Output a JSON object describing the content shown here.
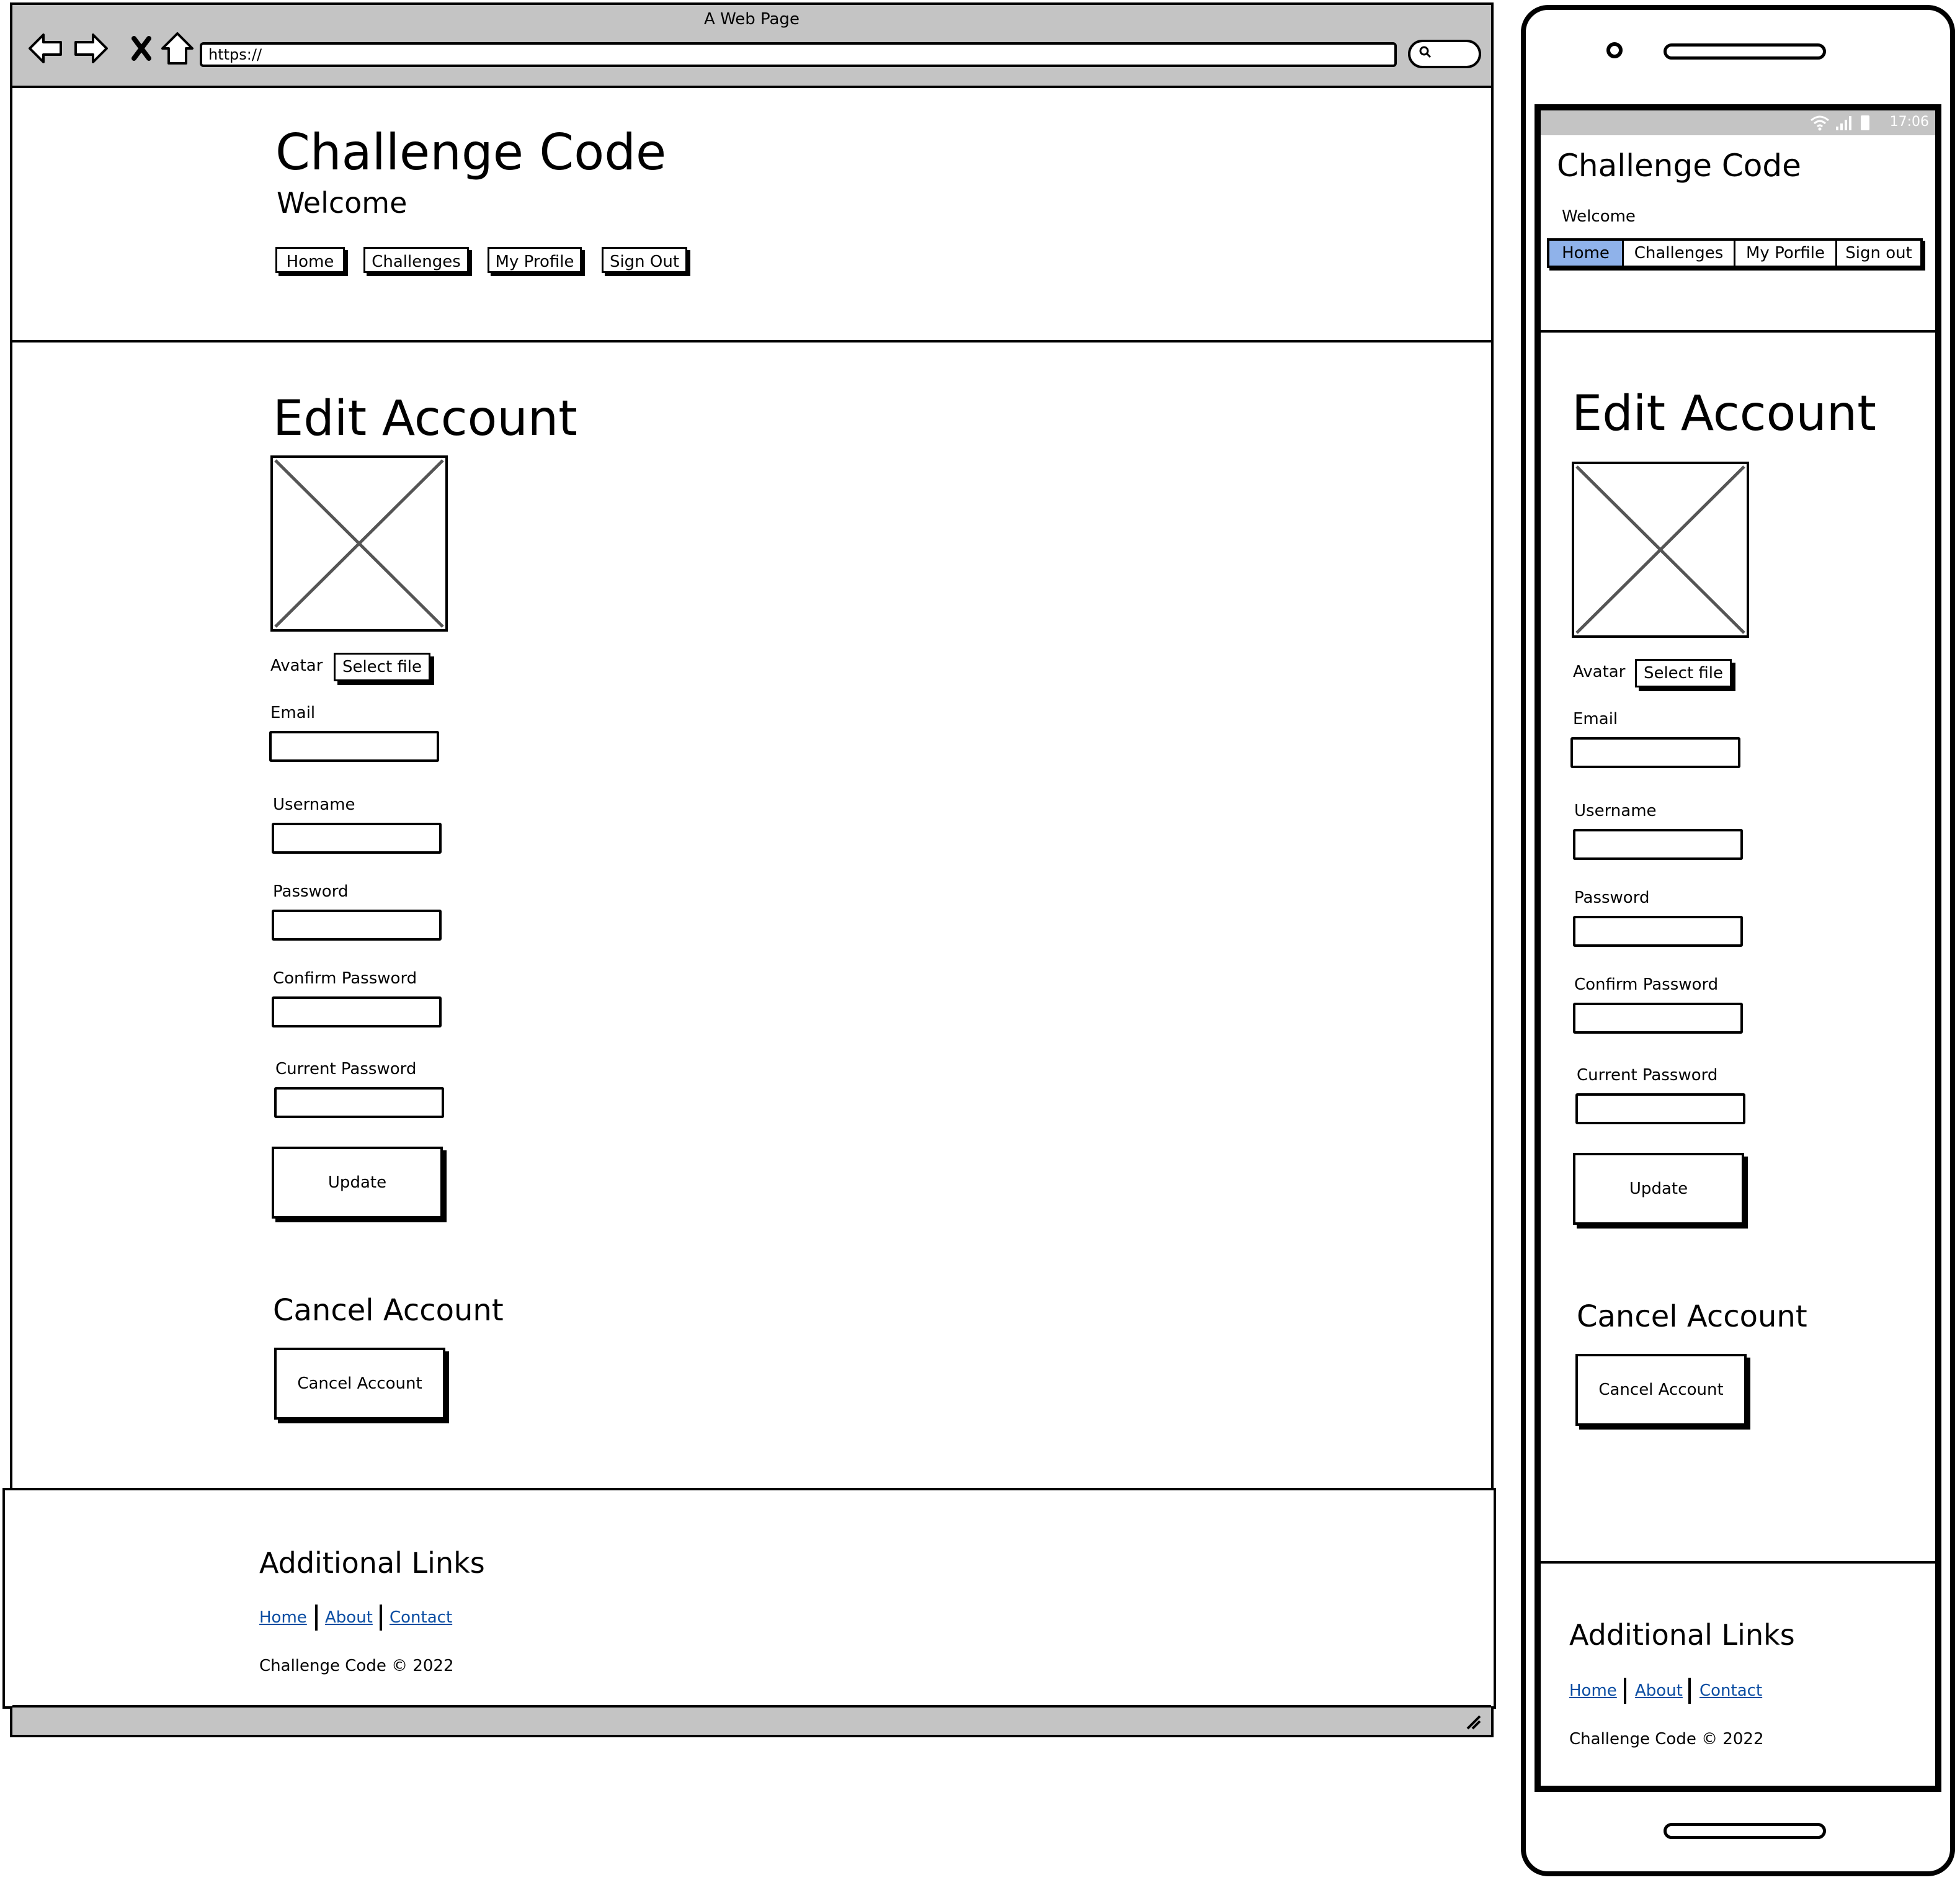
{
  "desktop": {
    "window_title": "A Web Page",
    "url": "https://",
    "site": {
      "title": "Challenge Code",
      "subtitle": "Welcome"
    },
    "nav": [
      {
        "label": "Home"
      },
      {
        "label": "Challenges"
      },
      {
        "label": "My Profile"
      },
      {
        "label": "Sign Out"
      }
    ],
    "form": {
      "heading": "Edit Account",
      "avatar_label": "Avatar",
      "select_file": "Select file",
      "email_label": "Email",
      "username_label": "Username",
      "password_label": "Password",
      "confirm_label": "Confirm Password",
      "current_label": "Current Password",
      "update_button": "Update"
    },
    "cancel": {
      "heading": "Cancel Account",
      "button": "Cancel Account"
    },
    "footer": {
      "heading": "Additional Links",
      "links": [
        "Home",
        "About",
        "Contact"
      ],
      "copyright": "Challenge Code © 2022"
    }
  },
  "mobile": {
    "status_time": "17:06",
    "site": {
      "title": "Challenge Code",
      "subtitle": "Welcome"
    },
    "tabs": [
      {
        "label": "Home",
        "active": true
      },
      {
        "label": "Challenges",
        "active": false
      },
      {
        "label": "My Porfile",
        "active": false
      },
      {
        "label": "Sign out",
        "active": false
      }
    ],
    "form": {
      "heading": "Edit Account",
      "avatar_label": "Avatar",
      "select_file": "Select file",
      "email_label": "Email",
      "username_label": "Username",
      "password_label": "Password",
      "confirm_label": "Confirm Password",
      "current_label": "Current Password",
      "update_button": "Update"
    },
    "cancel": {
      "heading": "Cancel Account",
      "button": "Cancel Account"
    },
    "footer": {
      "heading": "Additional Links",
      "links": [
        "Home",
        "About",
        "Contact"
      ],
      "copyright": "Challenge Code © 2022"
    }
  },
  "colors": {
    "chrome_gray": "#c4c4c4",
    "active_tab": "#8fb2ea",
    "link": "#0a4da2"
  },
  "icons": [
    "back-arrow-icon",
    "forward-arrow-icon",
    "stop-icon",
    "home-icon",
    "search-icon",
    "resize-grip-icon",
    "wifi-icon",
    "signal-icon",
    "battery-icon",
    "image-placeholder-icon"
  ]
}
